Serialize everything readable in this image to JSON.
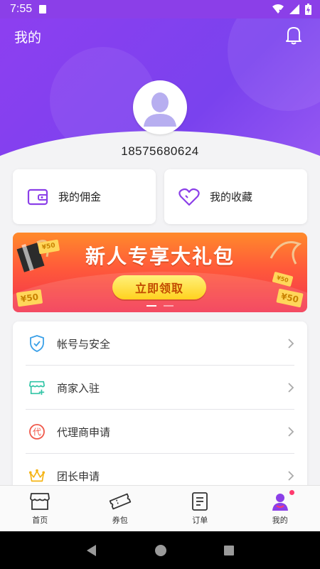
{
  "status_bar": {
    "time": "7:55"
  },
  "header": {
    "title": "我的"
  },
  "profile": {
    "phone": "18575680624"
  },
  "quick_cards": [
    {
      "label": "我的佣金",
      "icon": "wallet-icon"
    },
    {
      "label": "我的收藏",
      "icon": "heart-icon"
    }
  ],
  "banner": {
    "headline": "新人专享大礼包",
    "cta": "立即领取",
    "coupon_text": "¥50",
    "colors": {
      "top": "#ff8a2b",
      "bottom": "#f2324e"
    }
  },
  "menu": [
    {
      "label": "帐号与安全",
      "icon": "shield-check-icon"
    },
    {
      "label": "商家入驻",
      "icon": "storefront-icon"
    },
    {
      "label": "代理商申请",
      "icon": "agent-badge-icon",
      "icon_text": "代"
    },
    {
      "label": "团长申请",
      "icon": "crown-icon"
    }
  ],
  "bottom_nav": [
    {
      "label": "首页",
      "icon": "store-icon"
    },
    {
      "label": "券包",
      "icon": "ticket-icon"
    },
    {
      "label": "订单",
      "icon": "order-list-icon"
    },
    {
      "label": "我的",
      "icon": "person-icon",
      "active": true
    }
  ],
  "colors": {
    "accent": "#8b3fe8",
    "badge": "#ff3a6e"
  }
}
